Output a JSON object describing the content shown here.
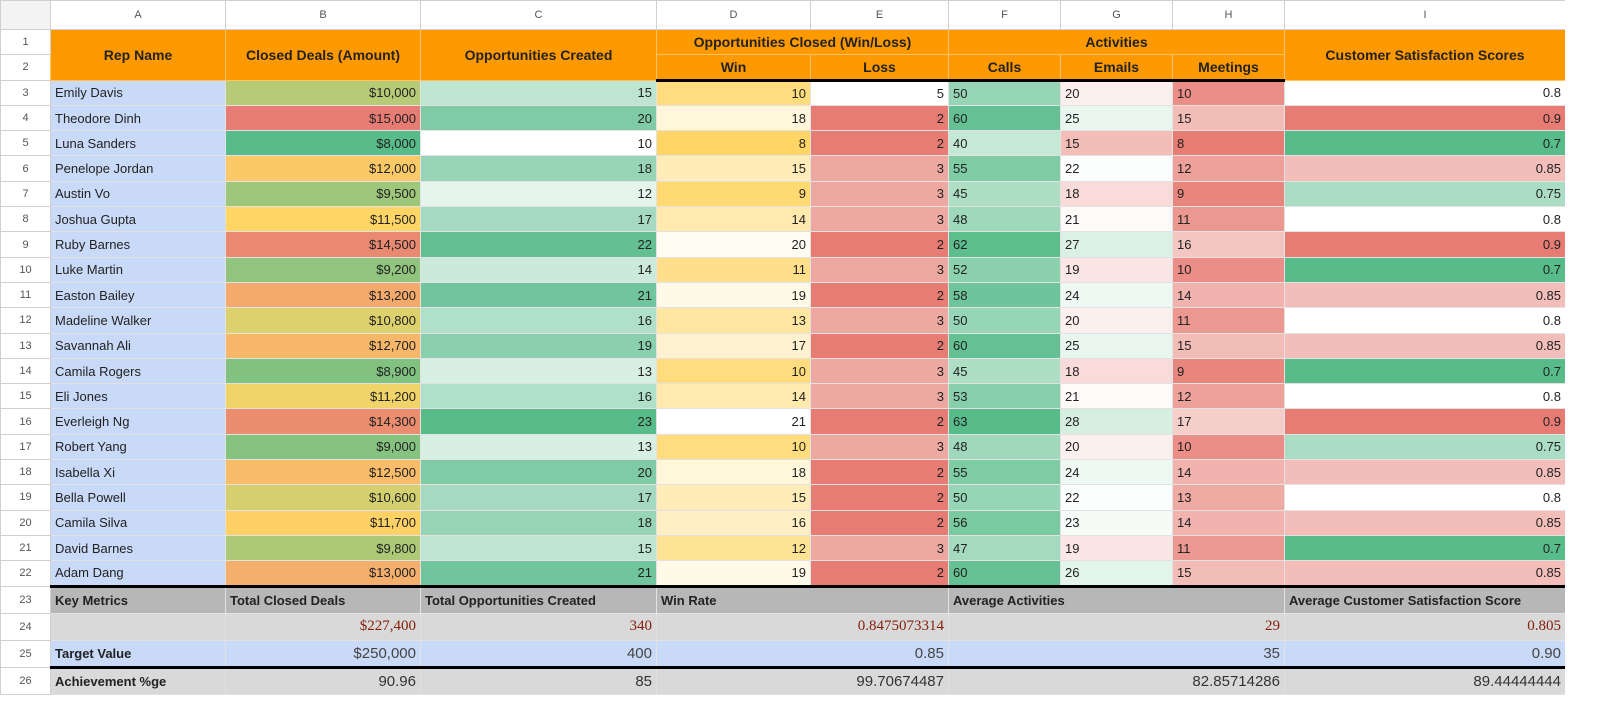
{
  "columns": [
    "A",
    "B",
    "C",
    "D",
    "E",
    "F",
    "G",
    "H",
    "I"
  ],
  "header": {
    "rep_name": "Rep Name",
    "closed_deals": "Closed Deals (Amount)",
    "opps_created": "Opportunities Created",
    "opps_closed": "Opportunities Closed (Win/Loss)",
    "win": "Win",
    "loss": "Loss",
    "activities": "Activities",
    "calls": "Calls",
    "emails": "Emails",
    "meetings": "Meetings",
    "csat": "Customer Satisfaction Scores"
  },
  "rows": [
    {
      "name": "Emily Davis",
      "deals": "$10,000",
      "deals_v": 10000,
      "opps": 15,
      "win": 10,
      "loss": 5,
      "calls": 50,
      "emails": 20,
      "meetings": 10,
      "csat": "0.8"
    },
    {
      "name": "Theodore Dinh",
      "deals": "$15,000",
      "deals_v": 15000,
      "opps": 20,
      "win": 18,
      "loss": 2,
      "calls": 60,
      "emails": 25,
      "meetings": 15,
      "csat": "0.9"
    },
    {
      "name": "Luna Sanders",
      "deals": "$8,000",
      "deals_v": 8000,
      "opps": 10,
      "win": 8,
      "loss": 2,
      "calls": 40,
      "emails": 15,
      "meetings": 8,
      "csat": "0.7"
    },
    {
      "name": "Penelope Jordan",
      "deals": "$12,000",
      "deals_v": 12000,
      "opps": 18,
      "win": 15,
      "loss": 3,
      "calls": 55,
      "emails": 22,
      "meetings": 12,
      "csat": "0.85"
    },
    {
      "name": "Austin Vo",
      "deals": "$9,500",
      "deals_v": 9500,
      "opps": 12,
      "win": 9,
      "loss": 3,
      "calls": 45,
      "emails": 18,
      "meetings": 9,
      "csat": "0.75"
    },
    {
      "name": "Joshua Gupta",
      "deals": "$11,500",
      "deals_v": 11500,
      "opps": 17,
      "win": 14,
      "loss": 3,
      "calls": 48,
      "emails": 21,
      "meetings": 11,
      "csat": "0.8"
    },
    {
      "name": "Ruby Barnes",
      "deals": "$14,500",
      "deals_v": 14500,
      "opps": 22,
      "win": 20,
      "loss": 2,
      "calls": 62,
      "emails": 27,
      "meetings": 16,
      "csat": "0.9"
    },
    {
      "name": "Luke Martin",
      "deals": "$9,200",
      "deals_v": 9200,
      "opps": 14,
      "win": 11,
      "loss": 3,
      "calls": 52,
      "emails": 19,
      "meetings": 10,
      "csat": "0.7"
    },
    {
      "name": "Easton Bailey",
      "deals": "$13,200",
      "deals_v": 13200,
      "opps": 21,
      "win": 19,
      "loss": 2,
      "calls": 58,
      "emails": 24,
      "meetings": 14,
      "csat": "0.85"
    },
    {
      "name": "Madeline Walker",
      "deals": "$10,800",
      "deals_v": 10800,
      "opps": 16,
      "win": 13,
      "loss": 3,
      "calls": 50,
      "emails": 20,
      "meetings": 11,
      "csat": "0.8"
    },
    {
      "name": "Savannah Ali",
      "deals": "$12,700",
      "deals_v": 12700,
      "opps": 19,
      "win": 17,
      "loss": 2,
      "calls": 60,
      "emails": 25,
      "meetings": 15,
      "csat": "0.85"
    },
    {
      "name": "Camila Rogers",
      "deals": "$8,900",
      "deals_v": 8900,
      "opps": 13,
      "win": 10,
      "loss": 3,
      "calls": 45,
      "emails": 18,
      "meetings": 9,
      "csat": "0.7"
    },
    {
      "name": "Eli Jones",
      "deals": "$11,200",
      "deals_v": 11200,
      "opps": 16,
      "win": 14,
      "loss": 3,
      "calls": 53,
      "emails": 21,
      "meetings": 12,
      "csat": "0.8"
    },
    {
      "name": "Everleigh Ng",
      "deals": "$14,300",
      "deals_v": 14300,
      "opps": 23,
      "win": 21,
      "loss": 2,
      "calls": 63,
      "emails": 28,
      "meetings": 17,
      "csat": "0.9"
    },
    {
      "name": "Robert Yang",
      "deals": "$9,000",
      "deals_v": 9000,
      "opps": 13,
      "win": 10,
      "loss": 3,
      "calls": 48,
      "emails": 20,
      "meetings": 10,
      "csat": "0.75"
    },
    {
      "name": "Isabella Xi",
      "deals": "$12,500",
      "deals_v": 12500,
      "opps": 20,
      "win": 18,
      "loss": 2,
      "calls": 55,
      "emails": 24,
      "meetings": 14,
      "csat": "0.85"
    },
    {
      "name": "Bella Powell",
      "deals": "$10,600",
      "deals_v": 10600,
      "opps": 17,
      "win": 15,
      "loss": 2,
      "calls": 50,
      "emails": 22,
      "meetings": 13,
      "csat": "0.8"
    },
    {
      "name": "Camila Silva",
      "deals": "$11,700",
      "deals_v": 11700,
      "opps": 18,
      "win": 16,
      "loss": 2,
      "calls": 56,
      "emails": 23,
      "meetings": 14,
      "csat": "0.85"
    },
    {
      "name": "David Barnes",
      "deals": "$9,800",
      "deals_v": 9800,
      "opps": 15,
      "win": 12,
      "loss": 3,
      "calls": 47,
      "emails": 19,
      "meetings": 11,
      "csat": "0.7"
    },
    {
      "name": "Adam Dang",
      "deals": "$13,000",
      "deals_v": 13000,
      "opps": 21,
      "win": 19,
      "loss": 2,
      "calls": 60,
      "emails": 26,
      "meetings": 15,
      "csat": "0.85"
    }
  ],
  "metrics": {
    "key_metrics": "Key Metrics",
    "total_closed_deals": "Total Closed Deals",
    "total_opps_created": "Total Opportunities Created",
    "win_rate": "Win Rate",
    "avg_activities": "Average Activities",
    "avg_csat": "Average Customer Satisfaction Score",
    "actual": {
      "deals": "$227,400",
      "opps": "340",
      "win_rate": "0.8475073314",
      "activities": "29",
      "csat": "0.805"
    },
    "target_label": "Target Value",
    "target": {
      "deals": "$250,000",
      "opps": "400",
      "win_rate": "0.85",
      "activities": "35",
      "csat": "0.90"
    },
    "achievement_label": "Achievement %ge",
    "achievement": {
      "deals": "90.96",
      "opps": "85",
      "win_rate": "99.70674487",
      "activities": "82.85714286",
      "csat": "89.44444444"
    }
  },
  "color_scales": {
    "deals_v": [
      "#57bb8a",
      "#ffd666",
      "#e67c73"
    ],
    "opps": [
      "#ffffff",
      "#57bb8a"
    ],
    "win": [
      "#ffd666",
      "#ffffff"
    ],
    "loss": [
      "#e67c73",
      "#ffffff"
    ],
    "calls": [
      "#c6e9d6",
      "#57bb8a"
    ],
    "emails": [
      "#f3bdb8",
      "#ffffff",
      "#d6efe1"
    ],
    "meetings": [
      "#e67c73",
      "#f6cfcb"
    ],
    "csat": [
      "#57bb8a",
      "#ffffff",
      "#e67c73"
    ]
  },
  "colors": {
    "header": "#ff9900",
    "name_column": "#c9daf8",
    "key_metrics_row": "#b7b7b7",
    "value_rows": "#d9d9d9",
    "actual_text": "#85200c"
  }
}
